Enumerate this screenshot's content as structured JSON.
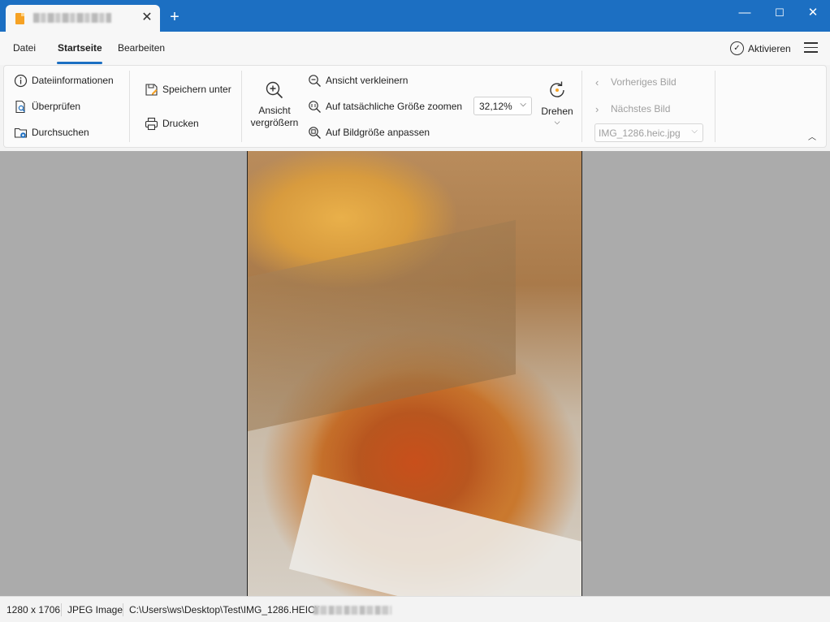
{
  "window": {
    "tab_close_glyph": "✕",
    "new_tab_glyph": "+",
    "minimize_glyph": "—",
    "maximize_glyph": "☐",
    "close_glyph": "✕"
  },
  "menu": {
    "items": [
      "Datei",
      "Startseite",
      "Bearbeiten"
    ],
    "active": "Startseite",
    "activate_label": "Aktivieren"
  },
  "ribbon": {
    "group1": [
      "Dateiinformationen",
      "Überprüfen",
      "Durchsuchen"
    ],
    "group2": [
      "Speichern unter",
      "Drucken"
    ],
    "zoom_in_label_line1": "Ansicht",
    "zoom_in_label_line2": "vergrößern",
    "zoom_out": "Ansicht verkleinern",
    "actual_size": "Auf tatsächliche Größe zoomen",
    "fit": "Auf Bildgröße anpassen",
    "zoom_value": "32,12%",
    "rotate": "Drehen",
    "prev_image": "Vorheriges Bild",
    "next_image": "Nächstes Bild",
    "image_select_value": "IMG_1286.heic.jpg"
  },
  "status": {
    "dimensions": "1280 x 1706",
    "format": "JPEG Image",
    "path": "C:\\Users\\ws\\Desktop\\Test\\IMG_1286.HEIC\\I"
  },
  "colors": {
    "accent": "#1c6fc2",
    "canvas_bg": "#ababab"
  }
}
